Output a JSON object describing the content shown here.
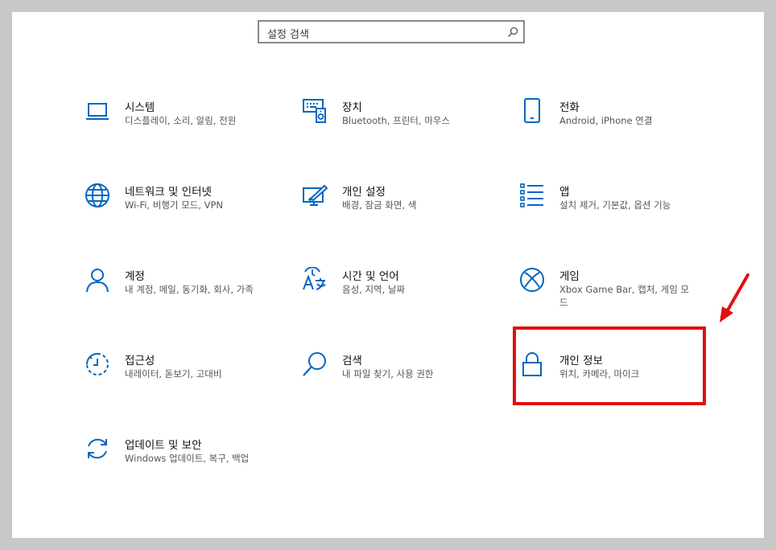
{
  "search": {
    "placeholder": "설정 검색",
    "icon": "search-icon"
  },
  "accent_color": "#0067c0",
  "highlight_color": "#e21010",
  "tiles": [
    {
      "title": "시스템",
      "desc": "디스플레이, 소리, 알림, 전원",
      "icon": "laptop-icon"
    },
    {
      "title": "장치",
      "desc": "Bluetooth, 프린터, 마우스",
      "icon": "devices-icon"
    },
    {
      "title": "전화",
      "desc": "Android, iPhone 연결",
      "icon": "phone-icon"
    },
    {
      "title": "네트워크 및 인터넷",
      "desc": "Wi-Fi, 비행기 모드, VPN",
      "icon": "globe-icon"
    },
    {
      "title": "개인 설정",
      "desc": "배경, 잠금 화면, 색",
      "icon": "personalization-icon"
    },
    {
      "title": "앱",
      "desc": "설치 제거, 기본값, 옵션 기능",
      "icon": "apps-list-icon"
    },
    {
      "title": "계정",
      "desc": "내 계정, 메일, 동기화, 회사, 가족",
      "icon": "person-icon"
    },
    {
      "title": "시간 및 언어",
      "desc": "음성, 지역, 날짜",
      "icon": "time-language-icon"
    },
    {
      "title": "게임",
      "desc": "Xbox Game Bar, 캡처, 게임 모드",
      "icon": "xbox-icon"
    },
    {
      "title": "접근성",
      "desc": "내레이터, 돋보기, 고대비",
      "icon": "accessibility-timer-icon"
    },
    {
      "title": "검색",
      "desc": "내 파일 찾기, 사용 권한",
      "icon": "magnifier-icon"
    },
    {
      "title": "개인 정보",
      "desc": "위치, 카메라, 마이크",
      "icon": "lock-icon"
    },
    {
      "title": "업데이트 및 보안",
      "desc": "Windows 업데이트, 복구, 백업",
      "icon": "sync-icon"
    }
  ]
}
